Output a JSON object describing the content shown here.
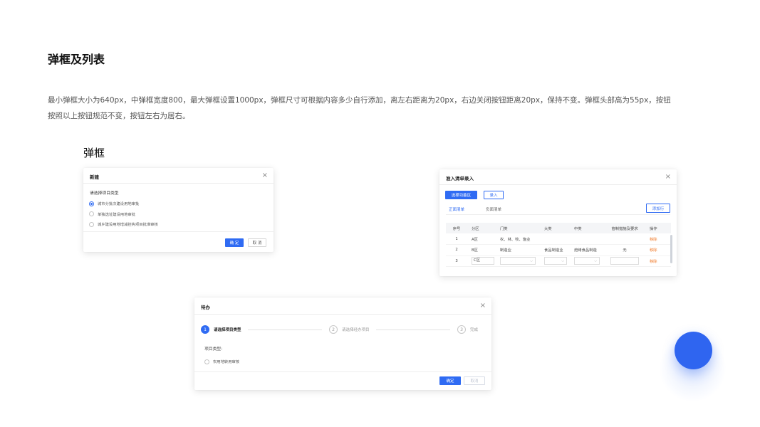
{
  "page": {
    "title": "弹框及列表",
    "description": "最小弹框大小为640px，中弹框宽度800，最大弹框设置1000px，弹框尺寸可根据内容多少自行添加，离左右距离为20px，右边关闭按钮距离20px，保持不变。弹框头部高为55px，按钮按照以上按钮规范不变，按钮左右为居右。",
    "section_title": "弹框"
  },
  "colors": {
    "primary": "#2f6bf3",
    "danger_text": "#f07a2a",
    "fab": "#2f65f0"
  },
  "modal_new": {
    "title": "新建",
    "close_icon": "×",
    "prompt": "请选择项目类型",
    "options": [
      {
        "label": "城市分批次建设用地审批",
        "checked": true
      },
      {
        "label": "单独选址建设用地审批",
        "checked": false
      },
      {
        "label": "城乡建设用地增减挂钩项目批准审核",
        "checked": false
      }
    ],
    "confirm_label": "确 定",
    "cancel_label": "取 消"
  },
  "modal_entry": {
    "title": "准入清单录入",
    "close_icon": "×",
    "select_area_label": "选择功能区",
    "entry_label": "录入",
    "tabs": [
      "正面清单",
      "负面清单"
    ],
    "add_row_label": "添加行",
    "columns": [
      "序号",
      "分区",
      "门类",
      "大类",
      "中类",
      "管制措施及要求",
      "操作"
    ],
    "rows": [
      {
        "no": "1",
        "zone": "A区",
        "category": "农、林、牧、渔业",
        "major": "",
        "middle": "",
        "measure": "",
        "action": "移除"
      },
      {
        "no": "2",
        "zone": "B区",
        "category": "制造业",
        "major": "食品制造业",
        "middle": "焙烤食品制造",
        "measure": "无",
        "action": "移除"
      },
      {
        "no": "3",
        "zone": "C区",
        "category": "",
        "major": "",
        "middle": "",
        "measure": "",
        "action": "移除"
      }
    ]
  },
  "modal_process": {
    "title": "待办",
    "close_icon": "×",
    "steps": [
      {
        "num": "1",
        "label": "请选择项目类型",
        "active": true
      },
      {
        "num": "2",
        "label": "请选择经办项目",
        "active": false
      },
      {
        "num": "3",
        "label": "完成",
        "active": false
      }
    ],
    "field_label": "项目类型:",
    "option_label": "农用地转用审核",
    "confirm_label": "确定",
    "cancel_label": "取消"
  },
  "fab": {
    "icon": "blue-circle-button"
  }
}
